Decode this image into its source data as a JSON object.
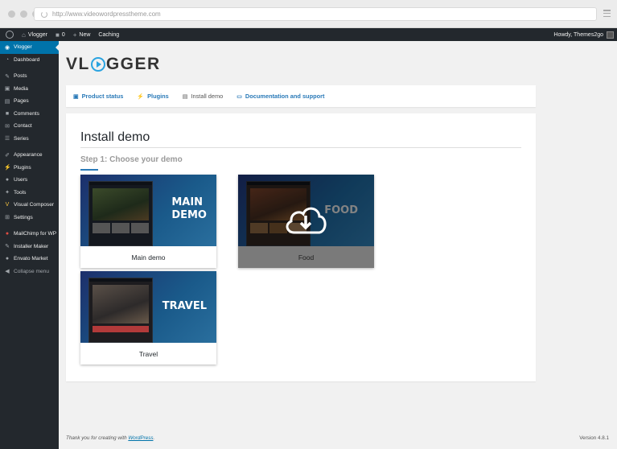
{
  "browser": {
    "url": "http://www.videowordpresstheme.com"
  },
  "adminbar": {
    "site": "Vlogger",
    "comments": "0",
    "new": "New",
    "caching": "Caching",
    "howdy": "Howdy, Themes2go"
  },
  "sidebar": {
    "items": [
      {
        "label": "Vlogger",
        "icon": "play-circle-icon",
        "active": true
      },
      {
        "label": "Dashboard",
        "icon": "dashboard-icon"
      },
      {
        "label": "Posts",
        "icon": "pin-icon"
      },
      {
        "label": "Media",
        "icon": "media-icon"
      },
      {
        "label": "Pages",
        "icon": "pages-icon"
      },
      {
        "label": "Comments",
        "icon": "comment-icon"
      },
      {
        "label": "Contact",
        "icon": "mail-icon"
      },
      {
        "label": "Series",
        "icon": "list-icon"
      },
      {
        "label": "Appearance",
        "icon": "brush-icon"
      },
      {
        "label": "Plugins",
        "icon": "plug-icon"
      },
      {
        "label": "Users",
        "icon": "user-icon"
      },
      {
        "label": "Tools",
        "icon": "wrench-icon"
      },
      {
        "label": "Visual Composer",
        "icon": "vc-icon"
      },
      {
        "label": "Settings",
        "icon": "settings-icon"
      },
      {
        "label": "MailChimp for WP",
        "icon": "mailchimp-icon"
      },
      {
        "label": "Installer Maker",
        "icon": "installer-icon"
      },
      {
        "label": "Envato Market",
        "icon": "envato-icon"
      },
      {
        "label": "Collapse menu",
        "icon": "collapse-icon"
      }
    ]
  },
  "logo": {
    "prefix": "VL",
    "suffix": "GGER"
  },
  "tabs": [
    {
      "label": "Product status",
      "icon": "status-icon"
    },
    {
      "label": "Plugins",
      "icon": "plug-icon"
    },
    {
      "label": "Install demo",
      "icon": "briefcase-icon",
      "current": true
    },
    {
      "label": "Documentation and support",
      "icon": "docs-icon"
    }
  ],
  "panel": {
    "title": "Install demo",
    "step": "Step 1: Choose your demo"
  },
  "demos": [
    {
      "label": "Main demo",
      "word1": "MAIN",
      "word2": "DEMO"
    },
    {
      "label": "Food",
      "word1": "FOOD",
      "word2": ""
    },
    {
      "label": "Travel",
      "word1": "TRAVEL",
      "word2": ""
    }
  ],
  "footer": {
    "thanks": "Thank you for creating with ",
    "wp_link": "WordPress",
    "dot": ".",
    "version": "Version 4.8.1"
  },
  "colors": {
    "accent": "#0073aa",
    "link": "#2a7ab8",
    "sidebar": "#23282d"
  }
}
